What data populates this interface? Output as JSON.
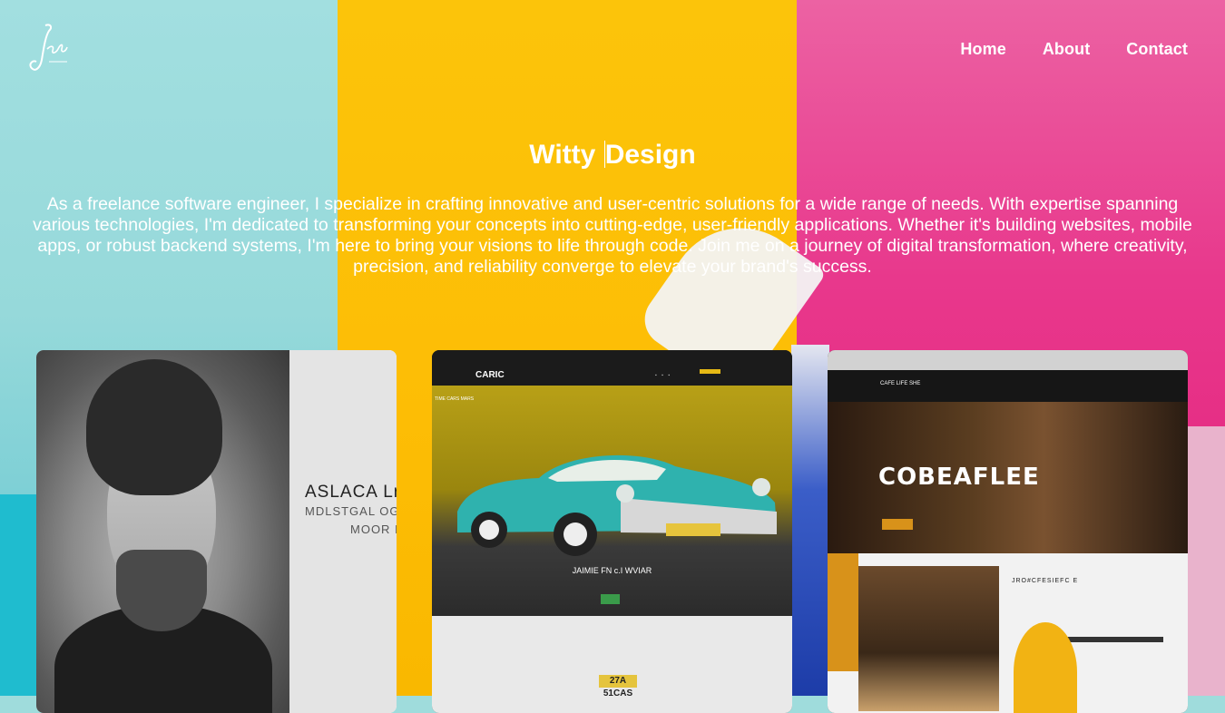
{
  "brand": {
    "logo_text": "Jade"
  },
  "nav": {
    "home": "Home",
    "about": "About",
    "contact": "Contact"
  },
  "hero": {
    "title_part1": "Witty",
    "title_part2": "Design",
    "description": "As a freelance software engineer, I specialize in crafting innovative and user-centric solutions for a wide range of needs. With expertise spanning various technologies, I'm dedicated to transforming your concepts into cutting-edge, user-friendly applications. Whether it's building websites, mobile apps, or robust backend systems, I'm here to bring your visions to life through code. Join me on a journey of digital transformation, where creativity, precision, and reliability converge to elevate your brand's success."
  },
  "portfolio": {
    "card1": {
      "line1": "ASLACA  Lr",
      "line2": "MDLSTGAL OGA",
      "line3": "MOOR I"
    },
    "card2": {
      "brand": "CARIC",
      "small_text": "TIME CARS MARS",
      "caption": "JAIMIE FN c.I WVIAR",
      "plate": "27A 51CAS"
    },
    "card3": {
      "brand": "CAFE LIFE SHE",
      "headline": "COBEAFLEE",
      "subheading": "JRO#CFESIEFC E"
    }
  },
  "colors": {
    "teal": "#a2dfe0",
    "yellow": "#fcc40a",
    "pink": "#e8388c"
  }
}
